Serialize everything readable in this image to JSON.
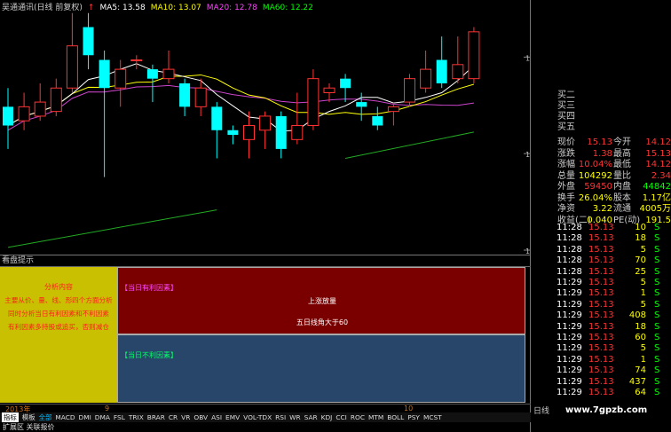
{
  "legend": {
    "title": "吴通通讯(日线 前复权)",
    "ma5": "MA5: 13.58",
    "ma10": "MA10: 13.07",
    "ma20": "MA20: 12.78",
    "ma60": "MA60: 12.22",
    "arrow": "↑"
  },
  "price_axis": [
    "13.08",
    "12.05",
    "11.02"
  ],
  "colors": {
    "up": "#ff3333",
    "down": "#00ffff",
    "ma5": "#ffffff",
    "ma10": "#ffff00",
    "ma20": "#cc44cc",
    "ma60": "#22aa22"
  },
  "quote": {
    "bids": [
      "买二",
      "买三",
      "买四",
      "买五"
    ],
    "rows": [
      {
        "l1": "现价",
        "v1": "15.13",
        "l2": "今开",
        "v2": "14.12",
        "c1": "red",
        "c2": "red"
      },
      {
        "l1": "涨跌",
        "v1": "1.38",
        "l2": "最高",
        "v2": "15.13",
        "c1": "red",
        "c2": "red"
      },
      {
        "l1": "涨幅",
        "v1": "10.04%",
        "l2": "最低",
        "v2": "14.12",
        "c1": "red",
        "c2": "red"
      },
      {
        "l1": "总量",
        "v1": "104292",
        "l2": "量比",
        "v2": "2.34",
        "c1": "yellow",
        "c2": "red"
      },
      {
        "l1": "外盘",
        "v1": "59450",
        "l2": "内盘",
        "v2": "44842",
        "c1": "red",
        "c2": "green"
      },
      {
        "l1": "换手",
        "v1": "26.04%",
        "l2": "股本",
        "v2": "1.17亿",
        "c1": "yellow",
        "c2": "yellow"
      },
      {
        "l1": "净资",
        "v1": "3.22",
        "l2": "流通",
        "v2": "4005万",
        "c1": "yellow",
        "c2": "yellow"
      },
      {
        "l1": "收益(二)",
        "v1": "0.040",
        "l2": "PE(动)",
        "v2": "191.5",
        "c1": "yellow",
        "c2": "yellow"
      }
    ]
  },
  "trades": [
    {
      "t": "11:28",
      "p": "15.13",
      "v": "10",
      "s": "S"
    },
    {
      "t": "11:28",
      "p": "15.13",
      "v": "18",
      "s": "S"
    },
    {
      "t": "11:28",
      "p": "15.13",
      "v": "5",
      "s": "S"
    },
    {
      "t": "11:28",
      "p": "15.13",
      "v": "70",
      "s": "S"
    },
    {
      "t": "11:28",
      "p": "15.13",
      "v": "25",
      "s": "S"
    },
    {
      "t": "11:29",
      "p": "15.13",
      "v": "5",
      "s": "S"
    },
    {
      "t": "11:29",
      "p": "15.13",
      "v": "1",
      "s": "S"
    },
    {
      "t": "11:29",
      "p": "15.13",
      "v": "5",
      "s": "S"
    },
    {
      "t": "11:29",
      "p": "15.13",
      "v": "408",
      "s": "S"
    },
    {
      "t": "11:29",
      "p": "15.13",
      "v": "18",
      "s": "S"
    },
    {
      "t": "11:29",
      "p": "15.13",
      "v": "60",
      "s": "S"
    },
    {
      "t": "11:29",
      "p": "15.13",
      "v": "5",
      "s": "S"
    },
    {
      "t": "11:29",
      "p": "15.13",
      "v": "1",
      "s": "S"
    },
    {
      "t": "11:29",
      "p": "15.13",
      "v": "74",
      "s": "S"
    },
    {
      "t": "11:29",
      "p": "15.13",
      "v": "437",
      "s": "S"
    },
    {
      "t": "11:29",
      "p": "15.13",
      "v": "64",
      "s": "S"
    }
  ],
  "analysis": {
    "panel_title": "看盘提示",
    "left_title": "分析内容",
    "left_lines": [
      "主要从价、量、线、形四个方面分析",
      "同时分析当日有利因素和不利因素",
      "有利因素多持股或追买，否则减仓"
    ],
    "fav_label": "【当日有利因素】",
    "fav_items": [
      "上涨放量",
      "五日线角大于60"
    ],
    "unfav_label": "【当日不利因素】"
  },
  "timeline": {
    "year": "2013年",
    "m1": "9",
    "m2": "10"
  },
  "indicators": [
    "指标",
    "模板",
    "全部",
    "MACD",
    "DMI",
    "DMA",
    "FSL",
    "TRIX",
    "BRAR",
    "CR",
    "VR",
    "OBV",
    "ASI",
    "EMV",
    "VOL-TDX",
    "RSI",
    "WR",
    "SAR",
    "KDJ",
    "CCI",
    "ROC",
    "MTM",
    "BOLL",
    "PSY",
    "MCST"
  ],
  "status": "扩展区   关联报价",
  "day_tab": "日线",
  "watermark": "www.7gpzb.com",
  "chart_data": {
    "type": "candlestick",
    "ylim": [
      11.02,
      13.5
    ],
    "candles": [
      {
        "o": 12.55,
        "c": 12.35,
        "h": 12.75,
        "l": 12.1
      },
      {
        "o": 12.4,
        "c": 12.55,
        "h": 12.7,
        "l": 12.3
      },
      {
        "o": 12.45,
        "c": 12.6,
        "h": 12.8,
        "l": 12.4
      },
      {
        "o": 12.5,
        "c": 12.75,
        "h": 12.85,
        "l": 12.45
      },
      {
        "o": 12.75,
        "c": 13.2,
        "h": 13.55,
        "l": 12.7
      },
      {
        "o": 13.4,
        "c": 13.1,
        "h": 13.55,
        "l": 12.95
      },
      {
        "o": 13.05,
        "c": 12.75,
        "h": 13.15,
        "l": 11.8
      },
      {
        "o": 12.75,
        "c": 12.95,
        "h": 13.05,
        "l": 12.55
      },
      {
        "o": 13.05,
        "c": 13.05,
        "h": 13.1,
        "l": 12.95
      },
      {
        "o": 12.95,
        "c": 12.85,
        "h": 13.0,
        "l": 12.6
      },
      {
        "o": 12.85,
        "c": 12.95,
        "h": 13.15,
        "l": 12.8
      },
      {
        "o": 12.8,
        "c": 12.55,
        "h": 12.85,
        "l": 12.45
      },
      {
        "o": 12.55,
        "c": 12.75,
        "h": 12.85,
        "l": 12.45
      },
      {
        "o": 12.55,
        "c": 12.3,
        "h": 12.6,
        "l": 12.0
      },
      {
        "o": 12.3,
        "c": 12.25,
        "h": 12.35,
        "l": 12.15
      },
      {
        "o": 12.2,
        "c": 12.35,
        "h": 12.5,
        "l": 12.0
      },
      {
        "o": 12.3,
        "c": 12.45,
        "h": 12.5,
        "l": 12.1
      },
      {
        "o": 12.45,
        "c": 12.1,
        "h": 12.5,
        "l": 12.0
      },
      {
        "o": 12.2,
        "c": 12.35,
        "h": 12.7,
        "l": 12.15
      },
      {
        "o": 12.35,
        "c": 12.85,
        "h": 12.95,
        "l": 12.3
      },
      {
        "o": 12.7,
        "c": 12.75,
        "h": 12.8,
        "l": 12.6
      },
      {
        "o": 12.85,
        "c": 12.75,
        "h": 12.9,
        "l": 12.6
      },
      {
        "o": 12.6,
        "c": 12.55,
        "h": 12.7,
        "l": 12.4
      },
      {
        "o": 12.45,
        "c": 12.35,
        "h": 12.55,
        "l": 12.3
      },
      {
        "o": 12.5,
        "c": 12.55,
        "h": 12.6,
        "l": 12.35
      },
      {
        "o": 12.6,
        "c": 12.85,
        "h": 12.9,
        "l": 12.55
      },
      {
        "o": 12.75,
        "c": 12.95,
        "h": 13.15,
        "l": 12.7
      },
      {
        "o": 13.05,
        "c": 12.8,
        "h": 13.3,
        "l": 12.75
      },
      {
        "o": 12.85,
        "c": 13.0,
        "h": 13.3,
        "l": 12.8
      },
      {
        "o": 12.85,
        "c": 13.35,
        "h": 13.4,
        "l": 12.8
      }
    ]
  }
}
